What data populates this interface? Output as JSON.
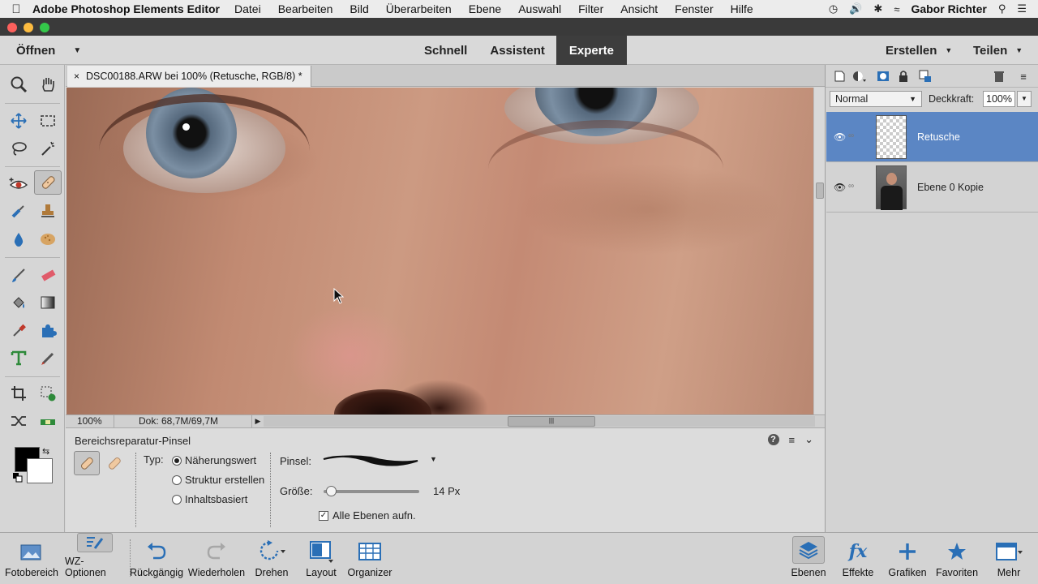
{
  "menubar": {
    "app_name": "Adobe Photoshop Elements Editor",
    "items": [
      "Datei",
      "Bearbeiten",
      "Bild",
      "Überarbeiten",
      "Ebene",
      "Auswahl",
      "Filter",
      "Ansicht",
      "Fenster",
      "Hilfe"
    ],
    "user": "Gabor Richter"
  },
  "modebar": {
    "open_label": "Öffnen",
    "modes": [
      "Schnell",
      "Assistent",
      "Experte"
    ],
    "active_mode": "Experte",
    "create_label": "Erstellen",
    "share_label": "Teilen"
  },
  "document": {
    "tab_title": "DSC00188.ARW bei 100% (Retusche, RGB/8) *",
    "zoom": "100%",
    "doc_size": "Dok: 68,7M/69,7M"
  },
  "tool_options": {
    "title": "Bereichsreparatur-Pinsel",
    "type_label": "Typ:",
    "types": [
      "Näherungswert",
      "Struktur erstellen",
      "Inhaltsbasiert"
    ],
    "selected_type": "Näherungswert",
    "brush_label": "Pinsel:",
    "size_label": "Größe:",
    "size_value": "14 Px",
    "size_fraction": 0.03,
    "sample_all_label": "Alle Ebenen aufn.",
    "sample_all_checked": true
  },
  "layers": {
    "blend_mode": "Normal",
    "opacity_label": "Deckkraft:",
    "opacity_value": "100%",
    "items": [
      {
        "name": "Retusche",
        "selected": true,
        "thumb": "transparent"
      },
      {
        "name": "Ebene 0 Kopie",
        "selected": false,
        "thumb": "photo"
      }
    ]
  },
  "taskbar": {
    "left": [
      "Fotobereich",
      "WZ-Optionen",
      "Rückgängig",
      "Wiederholen",
      "Drehen",
      "Layout",
      "Organizer"
    ],
    "right": [
      "Ebenen",
      "Effekte",
      "Grafiken",
      "Favoriten",
      "Mehr"
    ]
  },
  "colors": {
    "accent_selected_layer": "#5b86c4",
    "active_mode_bg": "#3d3d3d",
    "foreground_color": "#000000",
    "background_color": "#ffffff"
  }
}
